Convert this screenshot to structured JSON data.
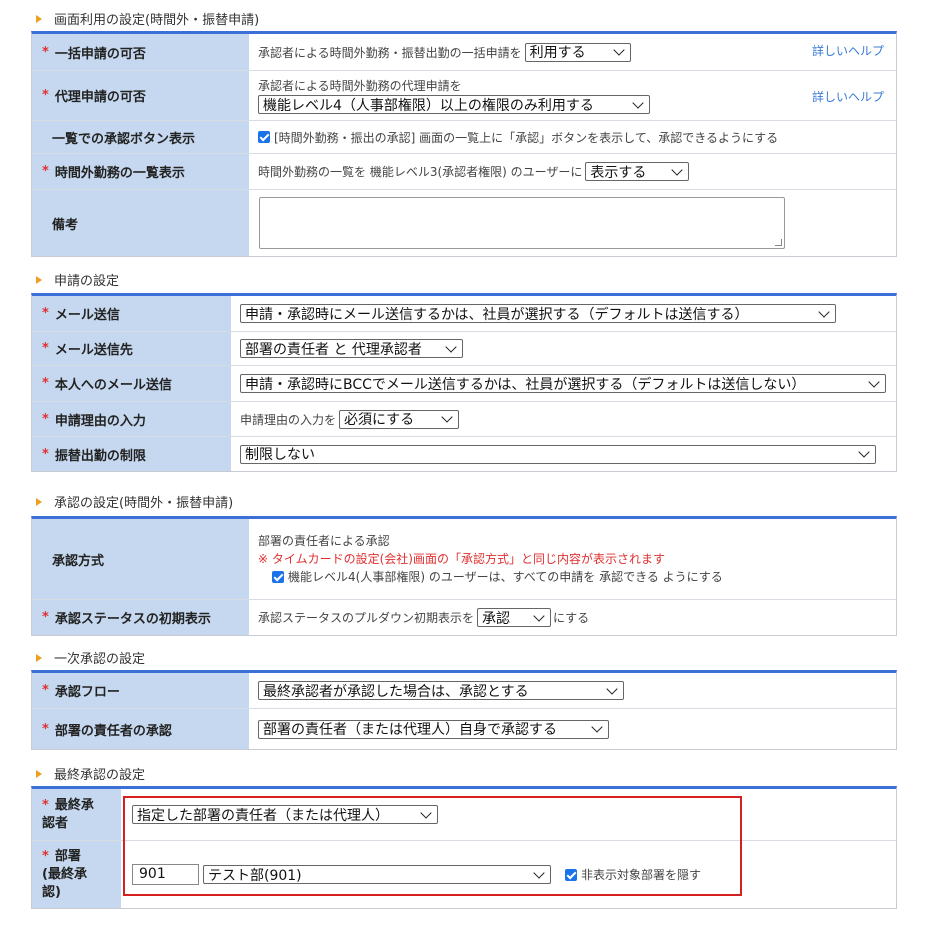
{
  "screen_usage": {
    "title": "画面利用の設定(時間外・振替申請)",
    "rows": {
      "bulk": {
        "label": "一括申請の可否",
        "text": "承認者による時間外勤務・振替出勤の一括申請を",
        "select": "利用する",
        "help": "詳しいヘルプ"
      },
      "proxy": {
        "label": "代理申請の可否",
        "text": "承認者による時間外勤務の代理申請を",
        "select": "機能レベル4（人事部権限）以上の権限のみ利用する",
        "help": "詳しいヘルプ"
      },
      "list_button": {
        "label": "一覧での承認ボタン表示",
        "text": "[時間外勤務・振出の承認] 画面の一覧上に「承認」ボタンを表示して、承認できるようにする"
      },
      "overtime_list": {
        "label": "時間外勤務の一覧表示",
        "text": "時間外勤務の一覧を  機能レベル3(承認者権限)  のユーザーに",
        "select": "表示する"
      },
      "remarks": {
        "label": "備考"
      }
    }
  },
  "application": {
    "title": "申請の設定",
    "rows": {
      "mail": {
        "label": "メール送信",
        "select": "申請・承認時にメール送信するかは、社員が選択する（デフォルトは送信する）"
      },
      "mail_to": {
        "label": "メール送信先",
        "select": "部署の責任者 と 代理承認者"
      },
      "mail_self": {
        "label": "本人へのメール送信",
        "select": "申請・承認時にBCCでメール送信するかは、社員が選択する（デフォルトは送信しない）"
      },
      "reason": {
        "label": "申請理由の入力",
        "text": "申請理由の入力を",
        "select": "必須にする"
      },
      "transfer_limit": {
        "label": "振替出勤の制限",
        "select": "制限しない"
      }
    }
  },
  "approval": {
    "title": "承認の設定(時間外・振替申請)",
    "rows": {
      "method": {
        "label": "承認方式",
        "line1": "部署の責任者による承認",
        "note": "※ タイムカードの設定(会社)画面の「承認方式」と同じ内容が表示されます",
        "check": "機能レベル4(人事部権限)  のユーザーは、すべての申請を 承認できる ようにする"
      },
      "status": {
        "label": "承認ステータスの初期表示",
        "text": "承認ステータスのプルダウン初期表示を",
        "select": "承認",
        "suffix": "にする"
      }
    }
  },
  "first_approval": {
    "title": "一次承認の設定",
    "rows": {
      "flow": {
        "label": "承認フロー",
        "select": "最終承認者が承認した場合は、承認とする"
      },
      "manager": {
        "label": "部署の責任者の承認",
        "select": "部署の責任者（または代理人）自身で承認する"
      }
    }
  },
  "final_approval": {
    "title": "最終承認の設定",
    "rows": {
      "approver": {
        "label_l1": "最終承",
        "label_l2": "認者",
        "select": "指定した部署の責任者（または代理人）"
      },
      "dept": {
        "label_l1": "部署",
        "label_l2": "(最終承",
        "label_l3": "認)",
        "code": "901",
        "select": "テスト部(901)",
        "check": "非表示対象部署を隠す"
      }
    }
  },
  "required_mark": "*"
}
